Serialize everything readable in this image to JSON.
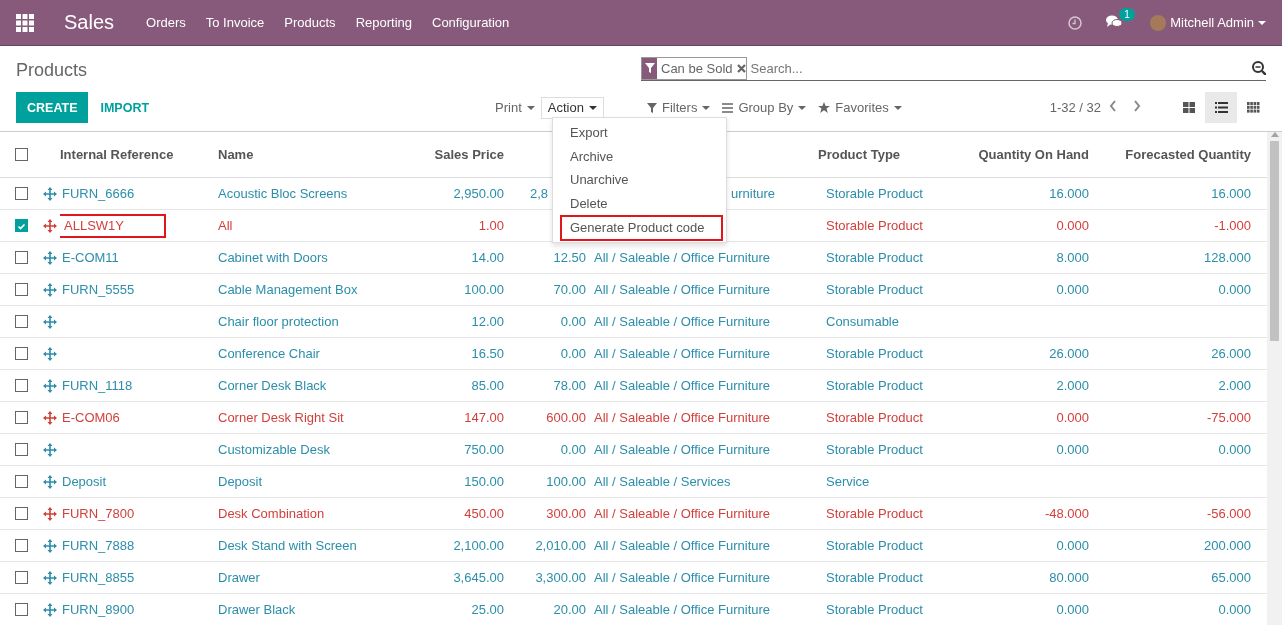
{
  "navbar": {
    "app": "Sales",
    "menus": [
      "Orders",
      "To Invoice",
      "Products",
      "Reporting",
      "Configuration"
    ],
    "notification_count": "1",
    "user": "Mitchell Admin"
  },
  "breadcrumb": "Products",
  "search": {
    "facet": "Can be Sold",
    "placeholder": "Search..."
  },
  "buttons": {
    "create": "CREATE",
    "import": "IMPORT"
  },
  "toolbar": {
    "print": "Print",
    "action": "Action",
    "filters": "Filters",
    "group_by": "Group By",
    "favorites": "Favorites",
    "pager": "1-32 / 32"
  },
  "views": [
    {
      "kind": "kanban",
      "selected": false
    },
    {
      "kind": "list",
      "selected": true
    },
    {
      "kind": "grid",
      "selected": false
    }
  ],
  "action_menu": [
    {
      "label": "Export",
      "highlighted": false
    },
    {
      "label": "Archive",
      "highlighted": false
    },
    {
      "label": "Unarchive",
      "highlighted": false
    },
    {
      "label": "Delete",
      "highlighted": false
    },
    {
      "label": "Generate Product code",
      "highlighted": true
    }
  ],
  "table": {
    "all_checked": false,
    "columns": [
      "Internal Reference",
      "Name",
      "Sales Price",
      "",
      "",
      "Product Type",
      "Quantity On Hand",
      "Forecasted Quantity"
    ],
    "rows": [
      {
        "checked": false,
        "warning": false,
        "highlighted": false,
        "under_menu": true,
        "ref": "FURN_6666",
        "name": "Acoustic Bloc Screens",
        "price": "2,950.00",
        "cost": "2,8",
        "category": "urniture",
        "type": "Storable Product",
        "on_hand": "16.000",
        "forecast": "16.000"
      },
      {
        "checked": true,
        "warning": true,
        "highlighted": true,
        "under_menu": true,
        "ref": "ALLSW1Y",
        "name": "All",
        "price": "1.00",
        "type": "Storable Product",
        "on_hand": "0.000",
        "forecast": "-1.000"
      },
      {
        "checked": false,
        "warning": false,
        "highlighted": false,
        "under_menu": false,
        "ref": "E-COM11",
        "name": "Cabinet with Doors",
        "price": "14.00",
        "cost": "12.50",
        "category": "All / Saleable / Office Furniture",
        "type": "Storable Product",
        "on_hand": "8.000",
        "forecast": "128.000"
      },
      {
        "checked": false,
        "warning": false,
        "highlighted": false,
        "under_menu": false,
        "ref": "FURN_5555",
        "name": "Cable Management Box",
        "price": "100.00",
        "cost": "70.00",
        "category": "All / Saleable / Office Furniture",
        "type": "Storable Product",
        "on_hand": "0.000",
        "forecast": "0.000"
      },
      {
        "checked": false,
        "warning": false,
        "highlighted": false,
        "under_menu": false,
        "name": "Chair floor protection",
        "price": "12.00",
        "cost": "0.00",
        "category": "All / Saleable / Office Furniture",
        "type": "Consumable"
      },
      {
        "checked": false,
        "warning": false,
        "highlighted": false,
        "under_menu": false,
        "name": "Conference Chair",
        "price": "16.50",
        "cost": "0.00",
        "category": "All / Saleable / Office Furniture",
        "type": "Storable Product",
        "on_hand": "26.000",
        "forecast": "26.000"
      },
      {
        "checked": false,
        "warning": false,
        "highlighted": false,
        "under_menu": false,
        "ref": "FURN_1118",
        "name": "Corner Desk Black",
        "price": "85.00",
        "cost": "78.00",
        "category": "All / Saleable / Office Furniture",
        "type": "Storable Product",
        "on_hand": "2.000",
        "forecast": "2.000"
      },
      {
        "checked": false,
        "warning": true,
        "highlighted": false,
        "under_menu": false,
        "ref": "E-COM06",
        "name": "Corner Desk Right Sit",
        "price": "147.00",
        "cost": "600.00",
        "category": "All / Saleable / Office Furniture",
        "type": "Storable Product",
        "on_hand": "0.000",
        "forecast": "-75.000"
      },
      {
        "checked": false,
        "warning": false,
        "highlighted": false,
        "under_menu": false,
        "name": "Customizable Desk",
        "price": "750.00",
        "cost": "0.00",
        "category": "All / Saleable / Office Furniture",
        "type": "Storable Product",
        "on_hand": "0.000",
        "forecast": "0.000"
      },
      {
        "checked": false,
        "warning": false,
        "highlighted": false,
        "under_menu": false,
        "ref": "Deposit",
        "name": "Deposit",
        "price": "150.00",
        "cost": "100.00",
        "category": "All / Saleable / Services",
        "type": "Service"
      },
      {
        "checked": false,
        "warning": true,
        "highlighted": false,
        "under_menu": false,
        "ref": "FURN_7800",
        "name": "Desk Combination",
        "price": "450.00",
        "cost": "300.00",
        "category": "All / Saleable / Office Furniture",
        "type": "Storable Product",
        "on_hand": "-48.000",
        "forecast": "-56.000"
      },
      {
        "checked": false,
        "warning": false,
        "highlighted": false,
        "under_menu": false,
        "ref": "FURN_7888",
        "name": "Desk Stand with Screen",
        "price": "2,100.00",
        "cost": "2,010.00",
        "category": "All / Saleable / Office Furniture",
        "type": "Storable Product",
        "on_hand": "0.000",
        "forecast": "200.000"
      },
      {
        "checked": false,
        "warning": false,
        "highlighted": false,
        "under_menu": false,
        "ref": "FURN_8855",
        "name": "Drawer",
        "price": "3,645.00",
        "cost": "3,300.00",
        "category": "All / Saleable / Office Furniture",
        "type": "Storable Product",
        "on_hand": "80.000",
        "forecast": "65.000"
      },
      {
        "checked": false,
        "warning": false,
        "highlighted": false,
        "under_menu": false,
        "ref": "FURN_8900",
        "name": "Drawer Black",
        "price": "25.00",
        "cost": "20.00",
        "category": "All / Saleable / Office Furniture",
        "type": "Storable Product",
        "on_hand": "0.000",
        "forecast": "0.000"
      }
    ]
  }
}
